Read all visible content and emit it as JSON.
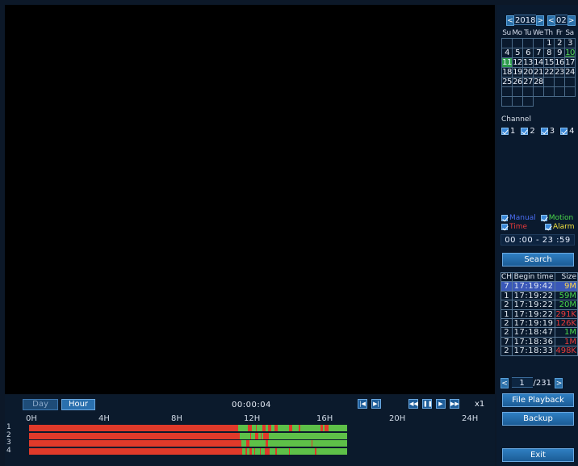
{
  "calendar": {
    "year": "2018",
    "month": "02",
    "prev_year": "<",
    "next_year": ">",
    "prev_month": "<",
    "next_month": ">",
    "weekdays": [
      "Su",
      "Mo",
      "Tu",
      "We",
      "Th",
      "Fr",
      "Sa"
    ],
    "days": [
      "",
      "",
      "",
      "",
      "1",
      "2",
      "3",
      "4",
      "5",
      "6",
      "7",
      "8",
      "9",
      "10",
      "11",
      "12",
      "13",
      "14",
      "15",
      "16",
      "17",
      "18",
      "19",
      "20",
      "21",
      "22",
      "23",
      "24",
      "25",
      "26",
      "27",
      "28",
      "",
      "",
      "",
      "",
      "",
      "",
      "",
      "",
      "",
      "",
      "",
      "",
      ""
    ],
    "recorded_days": [
      "10",
      "11"
    ],
    "selected_day": "11"
  },
  "channel": {
    "label": "Channel",
    "items": [
      "1",
      "2",
      "3",
      "4"
    ]
  },
  "record_types": {
    "manual": {
      "label": "Manual",
      "color": "#4a6cf0"
    },
    "motion": {
      "label": "Motion",
      "color": "#4ad84a"
    },
    "time": {
      "label": "Time",
      "color": "#e83a3a"
    },
    "alarm": {
      "label": "Alarm",
      "color": "#f0e040"
    }
  },
  "time_range": "00 :00 - 23 :59",
  "search_label": "Search",
  "file_list": {
    "headers": [
      "CH",
      "Begin time",
      "Size"
    ],
    "rows": [
      {
        "ch": "7",
        "time": "17:19:42",
        "size": "9M",
        "size_color": "#ffd84a",
        "highlight": true
      },
      {
        "ch": "1",
        "time": "17:19:22",
        "size": "59M",
        "size_color": "#4ad84a"
      },
      {
        "ch": "2",
        "time": "17:19:22",
        "size": "20M",
        "size_color": "#4ad84a"
      },
      {
        "ch": "1",
        "time": "17:19:22",
        "size": "291K",
        "size_color": "#e83a3a"
      },
      {
        "ch": "2",
        "time": "17:19:19",
        "size": "126K",
        "size_color": "#e83a3a"
      },
      {
        "ch": "2",
        "time": "17:18:47",
        "size": "1M",
        "size_color": "#4ad84a"
      },
      {
        "ch": "7",
        "time": "17:18:36",
        "size": "1M",
        "size_color": "#e83a3a"
      },
      {
        "ch": "2",
        "time": "17:18:33",
        "size": "498K",
        "size_color": "#e83a3a"
      }
    ],
    "page": "1",
    "total_pages": "/231",
    "prev": "<",
    "next": ">"
  },
  "file_playback_label": "File Playback",
  "backup_label": "Backup",
  "exit_label": "Exit",
  "timeline": {
    "day_label": "Day",
    "hour_label": "Hour",
    "clock": "00:00:04",
    "speed": "x1",
    "ticks": [
      "0H",
      "4H",
      "8H",
      "12H",
      "16H",
      "20H",
      "24H"
    ],
    "tracks": [
      "1",
      "2",
      "3",
      "4"
    ],
    "recorded_start_hour": 0,
    "motion_start_hour": 11.5,
    "recorded_end_hour": 17.5
  },
  "colors": {
    "accent": "#2f7fc2",
    "time_record": "#e03a2a",
    "motion_record": "#5ec048"
  }
}
